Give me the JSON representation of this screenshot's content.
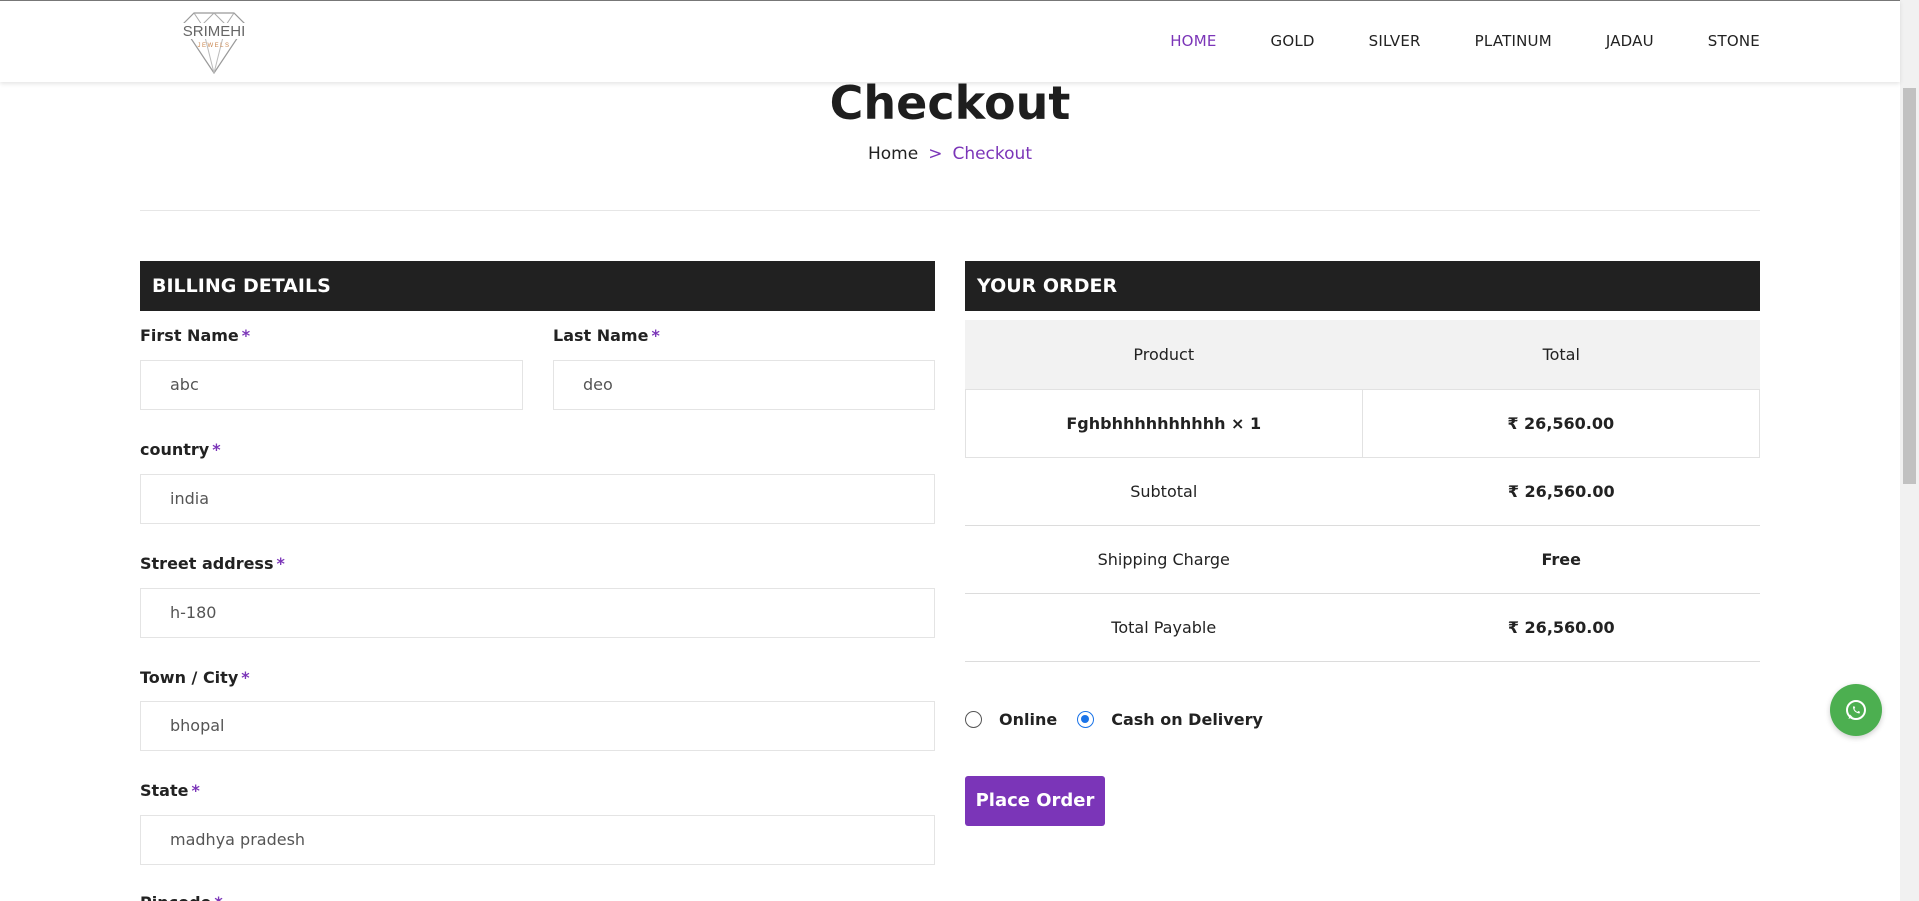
{
  "brand": {
    "logo_text": "SRIMEHI",
    "logo_subtext": "JEWELS"
  },
  "nav": {
    "items": [
      "HOME",
      "GOLD",
      "SILVER",
      "PLATINUM",
      "JADAU",
      "STONE"
    ],
    "active": "HOME"
  },
  "page": {
    "title": "Checkout",
    "breadcrumb": {
      "home": "Home",
      "separator": ">",
      "current": "Checkout"
    }
  },
  "billing": {
    "heading": "BILLING DETAILS",
    "required_mark": "*",
    "first_name": {
      "label": "First Name",
      "value": "abc"
    },
    "last_name": {
      "label": "Last Name",
      "value": "deo"
    },
    "country": {
      "label": "country",
      "value": "india"
    },
    "street": {
      "label": "Street address",
      "value": "h-180"
    },
    "city": {
      "label": "Town / City",
      "value": "bhopal"
    },
    "state": {
      "label": "State",
      "value": "madhya pradesh"
    },
    "pincode": {
      "label": "Pincode"
    }
  },
  "order": {
    "heading": "YOUR ORDER",
    "columns": [
      "Product",
      "Total"
    ],
    "product": {
      "name": "Fghbhhhhhhhhhh × 1",
      "total": "₹ 26,560.00"
    },
    "subtotal": {
      "label": "Subtotal",
      "value": "₹ 26,560.00"
    },
    "shipping": {
      "label": "Shipping Charge",
      "value": "Free"
    },
    "total": {
      "label": "Total Payable",
      "value": "₹ 26,560.00"
    }
  },
  "payment": {
    "options": [
      {
        "label": "Online",
        "selected": false
      },
      {
        "label": "Cash on Delivery",
        "selected": true
      }
    ],
    "place_order_label": "Place Order"
  },
  "colors": {
    "accent": "#7b35b8",
    "dark_bar": "#212121",
    "free": "#1e8c47",
    "whatsapp": "#4caf50"
  },
  "icons": {
    "whatsapp": "whatsapp-icon",
    "logo": "diamond-logo"
  }
}
